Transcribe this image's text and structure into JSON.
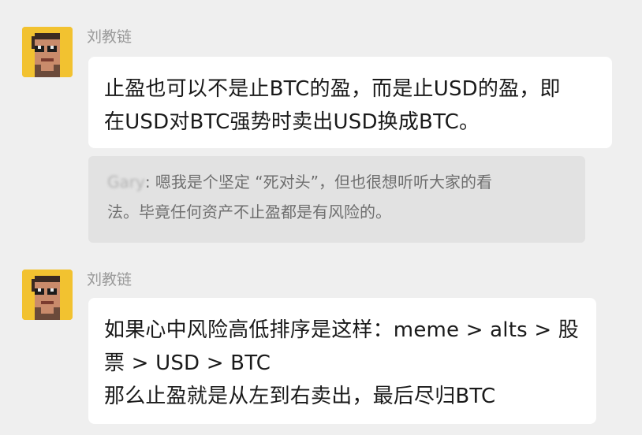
{
  "messages": [
    {
      "sender": "刘教链",
      "avatar_icon": "pixel-avatar-icon",
      "lines": [
        "止盈也可以不是止BTC的盈，而是止USD的盈，即",
        "在USD对BTC强势时卖出USD换成BTC。"
      ]
    },
    {
      "sender": "刘教链",
      "avatar_icon": "pixel-avatar-icon",
      "lines": [
        "如果心中风险高低排序是这样：meme > alts > 股",
        "票 > USD > BTC",
        "那么止盈就是从左到右卖出，最后尽归BTC"
      ]
    }
  ],
  "quote": {
    "name_blurred": "Gary",
    "lines": [
      ": 嗯我是个坚定 “死对头”，但也很想听听大家的看",
      "法。毕竟任何资产不止盈都是有风险的。"
    ]
  },
  "colors": {
    "background": "#efefef",
    "bubble": "#ffffff",
    "quote": "#e2e2e2",
    "avatar_bg": "#f2c230"
  }
}
